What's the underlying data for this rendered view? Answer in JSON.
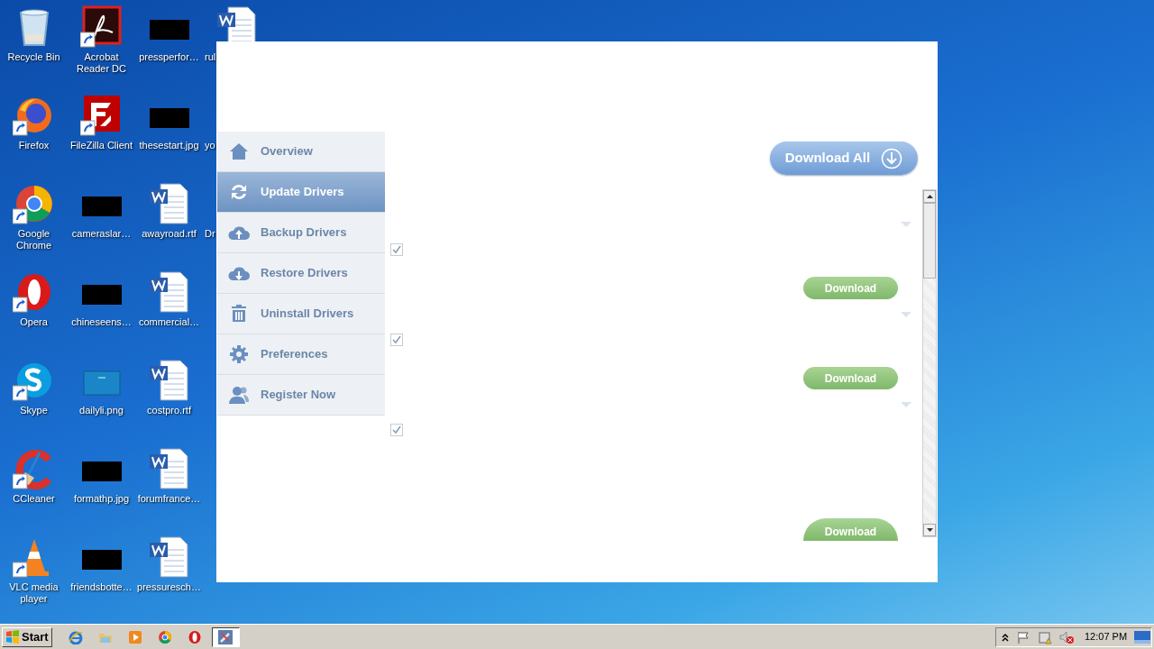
{
  "desktop": {
    "columns": [
      [
        {
          "label": "Recycle Bin",
          "kind": "recycle",
          "shortcut": false
        },
        {
          "label": "Firefox",
          "kind": "firefox",
          "shortcut": true
        },
        {
          "label": "Google\nChrome",
          "kind": "chrome",
          "shortcut": true
        },
        {
          "label": "Opera",
          "kind": "opera",
          "shortcut": true
        },
        {
          "label": "Skype",
          "kind": "skype",
          "shortcut": true
        },
        {
          "label": "CCleaner",
          "kind": "ccleaner",
          "shortcut": true
        },
        {
          "label": "VLC media\nplayer",
          "kind": "vlc",
          "shortcut": true
        }
      ],
      [
        {
          "label": "Acrobat\nReader DC",
          "kind": "acrobat",
          "shortcut": true
        },
        {
          "label": "FileZilla Client",
          "kind": "filezilla",
          "shortcut": true
        },
        {
          "label": "cameraslar…",
          "kind": "redacted",
          "shortcut": false
        },
        {
          "label": "chineseens…",
          "kind": "redacted",
          "shortcut": false
        },
        {
          "label": "dailyli.png",
          "kind": "image",
          "shortcut": false
        },
        {
          "label": "formathp.jpg",
          "kind": "redacted",
          "shortcut": false
        },
        {
          "label": "friendsbotte…",
          "kind": "redacted",
          "shortcut": false
        }
      ],
      [
        {
          "label": "pressperfor…",
          "kind": "redacted",
          "shortcut": false
        },
        {
          "label": "thesestart.jpg",
          "kind": "redacted",
          "shortcut": false
        },
        {
          "label": "awayroad.rtf",
          "kind": "word",
          "shortcut": false
        },
        {
          "label": "commercial…",
          "kind": "word",
          "shortcut": false
        },
        {
          "label": "costpro.rtf",
          "kind": "word",
          "shortcut": false
        },
        {
          "label": "forumfrance…",
          "kind": "word",
          "shortcut": false
        },
        {
          "label": "pressuresch…",
          "kind": "word",
          "shortcut": false
        }
      ],
      [
        {
          "label": "rul",
          "kind": "word",
          "shortcut": false
        },
        {
          "label": "yo",
          "kind": "hidden"
        },
        {
          "label": "Dr",
          "kind": "hidden"
        }
      ]
    ]
  },
  "app": {
    "sidebar": {
      "items": [
        {
          "label": "Overview",
          "selected": false
        },
        {
          "label": "Update Drivers",
          "selected": true
        },
        {
          "label": "Backup Drivers",
          "selected": false
        },
        {
          "label": "Restore Drivers",
          "selected": false
        },
        {
          "label": "Uninstall Drivers",
          "selected": false
        },
        {
          "label": "Preferences",
          "selected": false
        },
        {
          "label": "Register Now",
          "selected": false
        }
      ]
    },
    "download_all": "Download All",
    "drivers": [
      {
        "checked": true,
        "button": "Download"
      },
      {
        "checked": true,
        "button": "Download"
      },
      {
        "checked": true,
        "button": "Download"
      }
    ]
  },
  "taskbar": {
    "start": "Start",
    "tasks": [
      {
        "selected": true
      }
    ],
    "clock": "12:07 PM"
  }
}
